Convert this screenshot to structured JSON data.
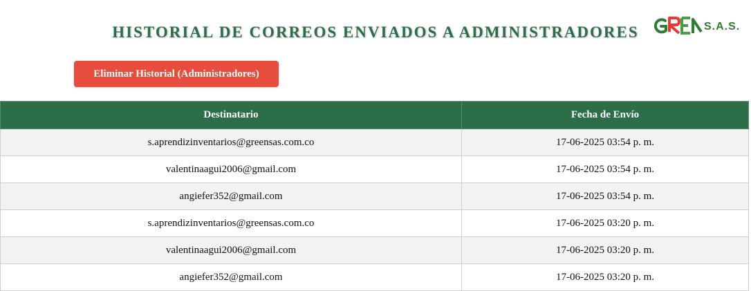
{
  "header": {
    "title": "HISTORIAL DE CORREOS ENVIADOS A ADMINISTRADORES"
  },
  "logo": {
    "text": "GREEN S.A.S.",
    "visible_suffix": "S.A.S.",
    "color": "#2e7d32"
  },
  "actions": {
    "delete_label": "Eliminar Historial (Administradores)",
    "delete_color": "#e74c3c"
  },
  "table": {
    "columns": [
      "Destinatario",
      "Fecha de Envío"
    ],
    "header_color": "#2b6e48",
    "rows": [
      {
        "recipient": "s.aprendizinventarios@greensas.com.co",
        "date": "17-06-2025 03:54 p. m."
      },
      {
        "recipient": "valentinaagui2006@gmail.com",
        "date": "17-06-2025 03:54 p. m."
      },
      {
        "recipient": "angiefer352@gmail.com",
        "date": "17-06-2025 03:54 p. m."
      },
      {
        "recipient": "s.aprendizinventarios@greensas.com.co",
        "date": "17-06-2025 03:20 p. m."
      },
      {
        "recipient": "valentinaagui2006@gmail.com",
        "date": "17-06-2025 03:20 p. m."
      },
      {
        "recipient": "angiefer352@gmail.com",
        "date": "17-06-2025 03:20 p. m."
      }
    ]
  }
}
